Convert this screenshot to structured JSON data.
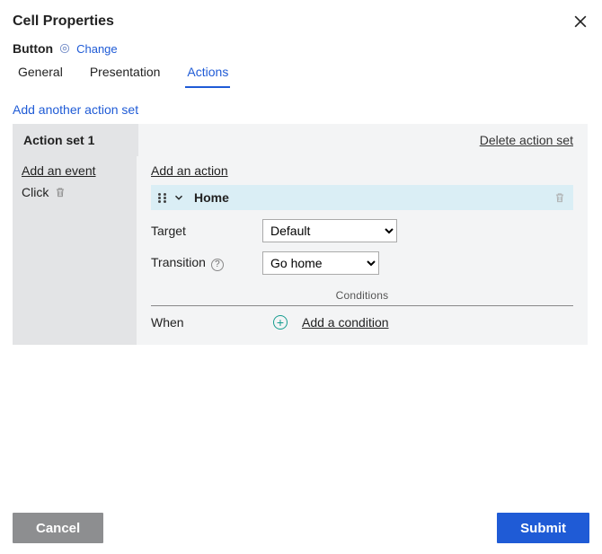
{
  "dialog": {
    "title": "Cell Properties",
    "type_label": "Button",
    "change_label": "Change",
    "tabs": {
      "general": "General",
      "presentation": "Presentation",
      "actions": "Actions",
      "active": "actions"
    }
  },
  "links": {
    "add_another_set": "Add another action set"
  },
  "action_set": {
    "title": "Action set 1",
    "delete_label": "Delete action set",
    "events": {
      "add_event": "Add an event",
      "items": [
        {
          "label": "Click"
        }
      ]
    },
    "actions": {
      "add_action": "Add an action",
      "items": [
        {
          "name": "Home",
          "fields": {
            "target_label": "Target",
            "target_value": "Default",
            "target_options": [
              "Default"
            ],
            "transition_label": "Transition",
            "transition_value": "Go home",
            "transition_options": [
              "Go home"
            ]
          },
          "conditions": {
            "header": "Conditions",
            "when_label": "When",
            "add_condition": "Add a condition"
          }
        }
      ]
    }
  },
  "buttons": {
    "cancel": "Cancel",
    "submit": "Submit"
  }
}
